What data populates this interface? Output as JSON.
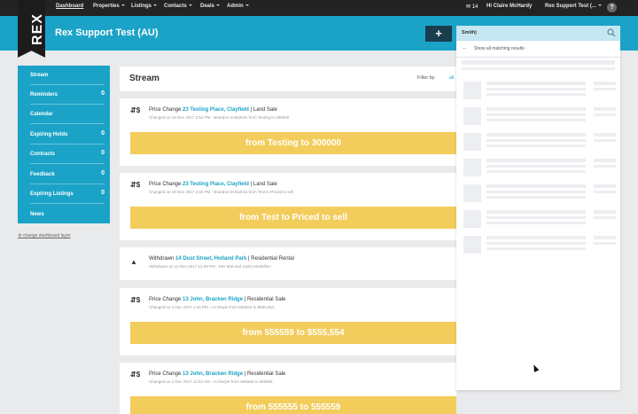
{
  "topnav": {
    "items": [
      {
        "label": "Dashboard",
        "active": true
      },
      {
        "label": "Properties",
        "caret": true
      },
      {
        "label": "Listings",
        "caret": true
      },
      {
        "label": "Contacts",
        "caret": true
      },
      {
        "label": "Deals",
        "caret": true
      },
      {
        "label": "Admin",
        "caret": true
      }
    ],
    "chat_count": "14",
    "user_label": "Hi Claire McHardy",
    "account_menu": "Rex Support Test (...",
    "help": "?"
  },
  "header": {
    "logo": "REX",
    "title": "Rex Support Test (AU)",
    "add_label": "+"
  },
  "search": {
    "value": "Smith|",
    "show_all": "Show all matching results"
  },
  "sidebar": {
    "items": [
      {
        "label": "Stream",
        "count": ""
      },
      {
        "label": "Reminders",
        "count": "0"
      },
      {
        "label": "Calendar",
        "count": ""
      },
      {
        "label": "Expiring Holds",
        "count": "0"
      },
      {
        "label": "Contracts",
        "count": "0"
      },
      {
        "label": "Feedback",
        "count": "0"
      },
      {
        "label": "Expiring Listings",
        "count": "0"
      },
      {
        "label": "News",
        "count": ""
      }
    ],
    "change_link": "change dashboard layer"
  },
  "stream": {
    "title": "Stream",
    "filter_label": "Filter by",
    "filter_value": "all",
    "cards": [
      {
        "icon": "price-change-icon",
        "event": "Price Change",
        "address": "23 Testing Place, Clayfield",
        "type": "| Land Sale",
        "meta": "Changed on 19 Dec 2017 2:52 PM - Brandon Di Bartolo from Testing to 300000",
        "banner": "from Testing to 300000"
      },
      {
        "icon": "price-change-icon",
        "event": "Price Change",
        "address": "23 Testing Place, Clayfield",
        "type": "| Land Sale",
        "meta": "Changed on 19 Dec 2017 2:49 PM - Brandon Di Bartolo from Test to Priced to sell",
        "banner": "from Test to Priced to sell"
      },
      {
        "icon": "withdrawn-icon",
        "event": "Withdrawn",
        "address": "14 Dust Street, Holland Park",
        "type": "| Residential Rental",
        "meta": "Withdrawn on 12 Dec 2017 12:29 PM - Kev Mat and Justin McMullen",
        "banner": ""
      },
      {
        "icon": "price-change-icon",
        "event": "Price Change",
        "address": "13 John, Bracken Ridge",
        "type": "| Residential Sale",
        "meta": "Changed on 4 Dec 2017 1:44 PM - AJ Dwyer from 555559 to $555,554",
        "banner": "from 555559 to $555,554"
      },
      {
        "icon": "price-change-icon",
        "event": "Price Change",
        "address": "13 John, Bracken Ridge",
        "type": "| Residential Sale",
        "meta": "Changed on 4 Dec 2017 11:52 AM - AJ Dwyer from 555555 to 555559",
        "banner": "from 555555 to 555559"
      }
    ]
  },
  "colors": {
    "brand_blue": "#1ba3c7",
    "banner_yellow": "#f2cd5c",
    "nav_dark": "#232323"
  }
}
